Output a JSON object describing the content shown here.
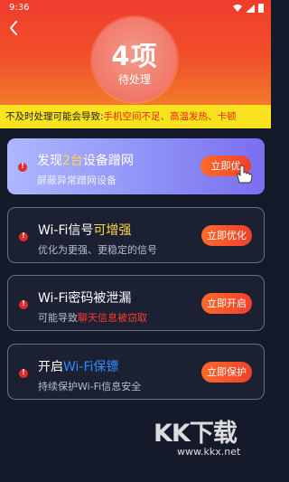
{
  "status_bar": {
    "time": "9:36"
  },
  "header": {
    "count": "4项",
    "count_label": "待处理"
  },
  "warning": {
    "prefix": "不及时处理可能会导致:",
    "highlight": "手机空间不足、高温发热、卡顿"
  },
  "cards": [
    {
      "title_pre": "发现",
      "title_hl": "2台",
      "title_post": "设备蹭网",
      "subtitle": "屏蔽异常蹭网设备",
      "button": "立即优化",
      "button_visible": "立即优"
    },
    {
      "title_pre": "Wi-Fi信号",
      "title_hl": "可增强",
      "subtitle": "优化为更强、更稳定的信号",
      "button": "立即优化"
    },
    {
      "title": "Wi-Fi密码被泄漏",
      "subtitle_pre": "可能导致",
      "subtitle_hl": "聊天信息被窃取",
      "button": "立即开启"
    },
    {
      "title_pre": "开启",
      "title_hl": "Wi-Fi保镖",
      "subtitle": "持续保护Wi-Fi信息安全",
      "button": "立即保护"
    }
  ],
  "watermark": {
    "logo": "KK下载",
    "url": "www.kkx.net"
  },
  "colors": {
    "header_red": "#f03c2c",
    "warning_yellow": "#f9e31e",
    "alert_red": "#e52a2a",
    "accent_blue": "#2f8cff",
    "accent_yellow": "#ffd84a"
  },
  "icons": [
    "back-arrow-icon",
    "wifi-icon",
    "signal-icon",
    "battery-icon",
    "alert-icon",
    "hand-pointer-icon"
  ]
}
